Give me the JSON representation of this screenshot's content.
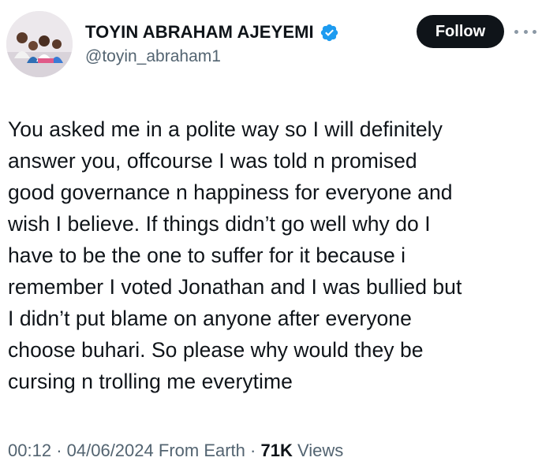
{
  "author": {
    "display_name": "TOYIN ABRAHAM AJEYEMI",
    "handle": "@toyin_abraham1",
    "verified": true,
    "avatar_icon": "family-photo-avatar"
  },
  "actions": {
    "follow_label": "Follow",
    "more_icon": "more-dots-icon"
  },
  "tweet": {
    "lines": [
      "You asked me in a polite way so I will definitely",
      "answer you, offcourse I was told n promised",
      "good governance n happiness for everyone and",
      "wish I believe. If things didn’t go well why do I",
      "have to be the one to suffer for it because i",
      "remember I voted Jonathan and I was bullied but",
      "I didn’t put blame on anyone after everyone",
      "choose buhari. So please why would they be",
      "cursing n trolling me everytime"
    ]
  },
  "meta": {
    "time": "00:12",
    "date": "04/06/2024",
    "source": "From Earth",
    "separator": "·",
    "views_count": "71K",
    "views_label": "Views"
  },
  "colors": {
    "text": "#0f1419",
    "secondary": "#536471",
    "verified_blue": "#1d9bf0",
    "button_bg": "#0f1419"
  }
}
